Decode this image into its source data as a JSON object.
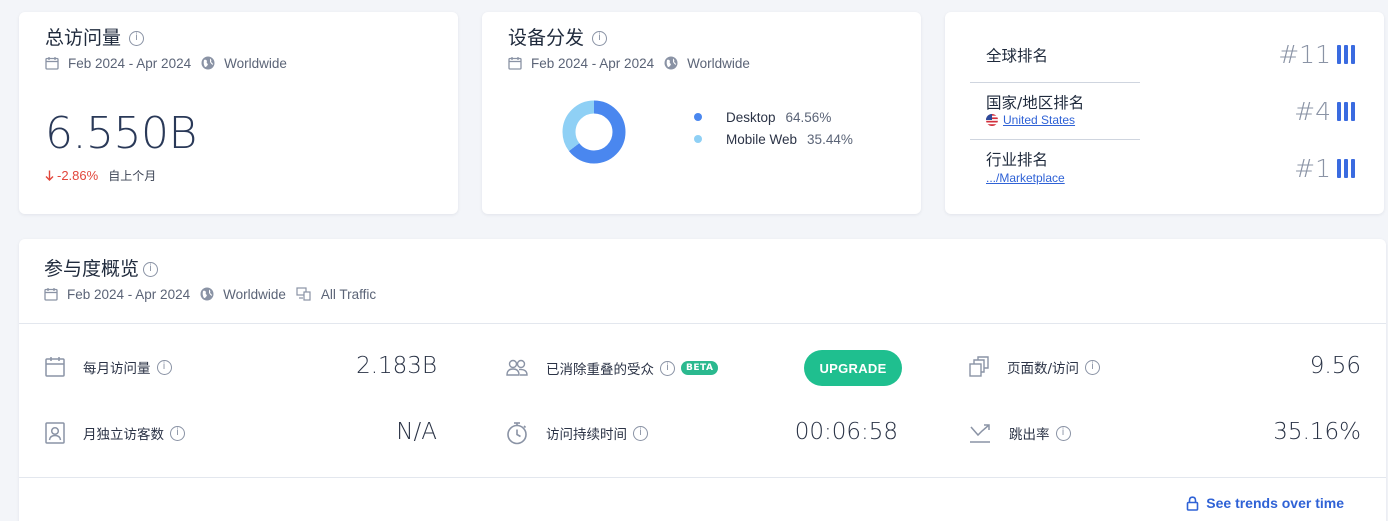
{
  "total_visits": {
    "title": "总访问量",
    "date_range": "Feb 2024 - Apr 2024",
    "region": "Worldwide",
    "value": "6.550B",
    "change": "-2.86%",
    "change_label": "自上个月"
  },
  "device": {
    "title": "设备分发",
    "date_range": "Feb 2024 - Apr 2024",
    "region": "Worldwide",
    "legend": [
      {
        "name": "Desktop",
        "pct": "64.56%",
        "value": 64.56,
        "color": "#4a87ef"
      },
      {
        "name": "Mobile Web",
        "pct": "35.44%",
        "value": 35.44,
        "color": "#8fd0f5"
      }
    ]
  },
  "ranks": {
    "global": {
      "label": "全球排名",
      "value": "#11"
    },
    "country": {
      "label": "国家/地区排名",
      "sub": "United States",
      "value": "#4"
    },
    "category": {
      "label": "行业排名",
      "sub": ".../Marketplace",
      "value": "#1"
    }
  },
  "engagement": {
    "title": "参与度概览",
    "date_range": "Feb 2024 - Apr 2024",
    "region": "Worldwide",
    "traffic": "All Traffic",
    "metrics": {
      "monthly_visits": {
        "label": "每月访问量",
        "value": "2.183B",
        "icon": "calendar-icon"
      },
      "dedup_audience": {
        "label": "已消除重叠的受众",
        "badge": "BETA",
        "button": "UPGRADE",
        "icon": "people-icon"
      },
      "pages_per_visit": {
        "label": "页面数/访问",
        "value": "9.56",
        "icon": "pages-icon"
      },
      "unique_visitors": {
        "label": "月独立访客数",
        "value": "N/A",
        "icon": "visitor-icon"
      },
      "visit_duration": {
        "label": "访问持续时间",
        "value": "00:06:58",
        "icon": "stopwatch-icon"
      },
      "bounce_rate": {
        "label": "跳出率",
        "value": "35.16%",
        "icon": "bounce-icon"
      }
    },
    "trends_link": "See trends over time"
  }
}
